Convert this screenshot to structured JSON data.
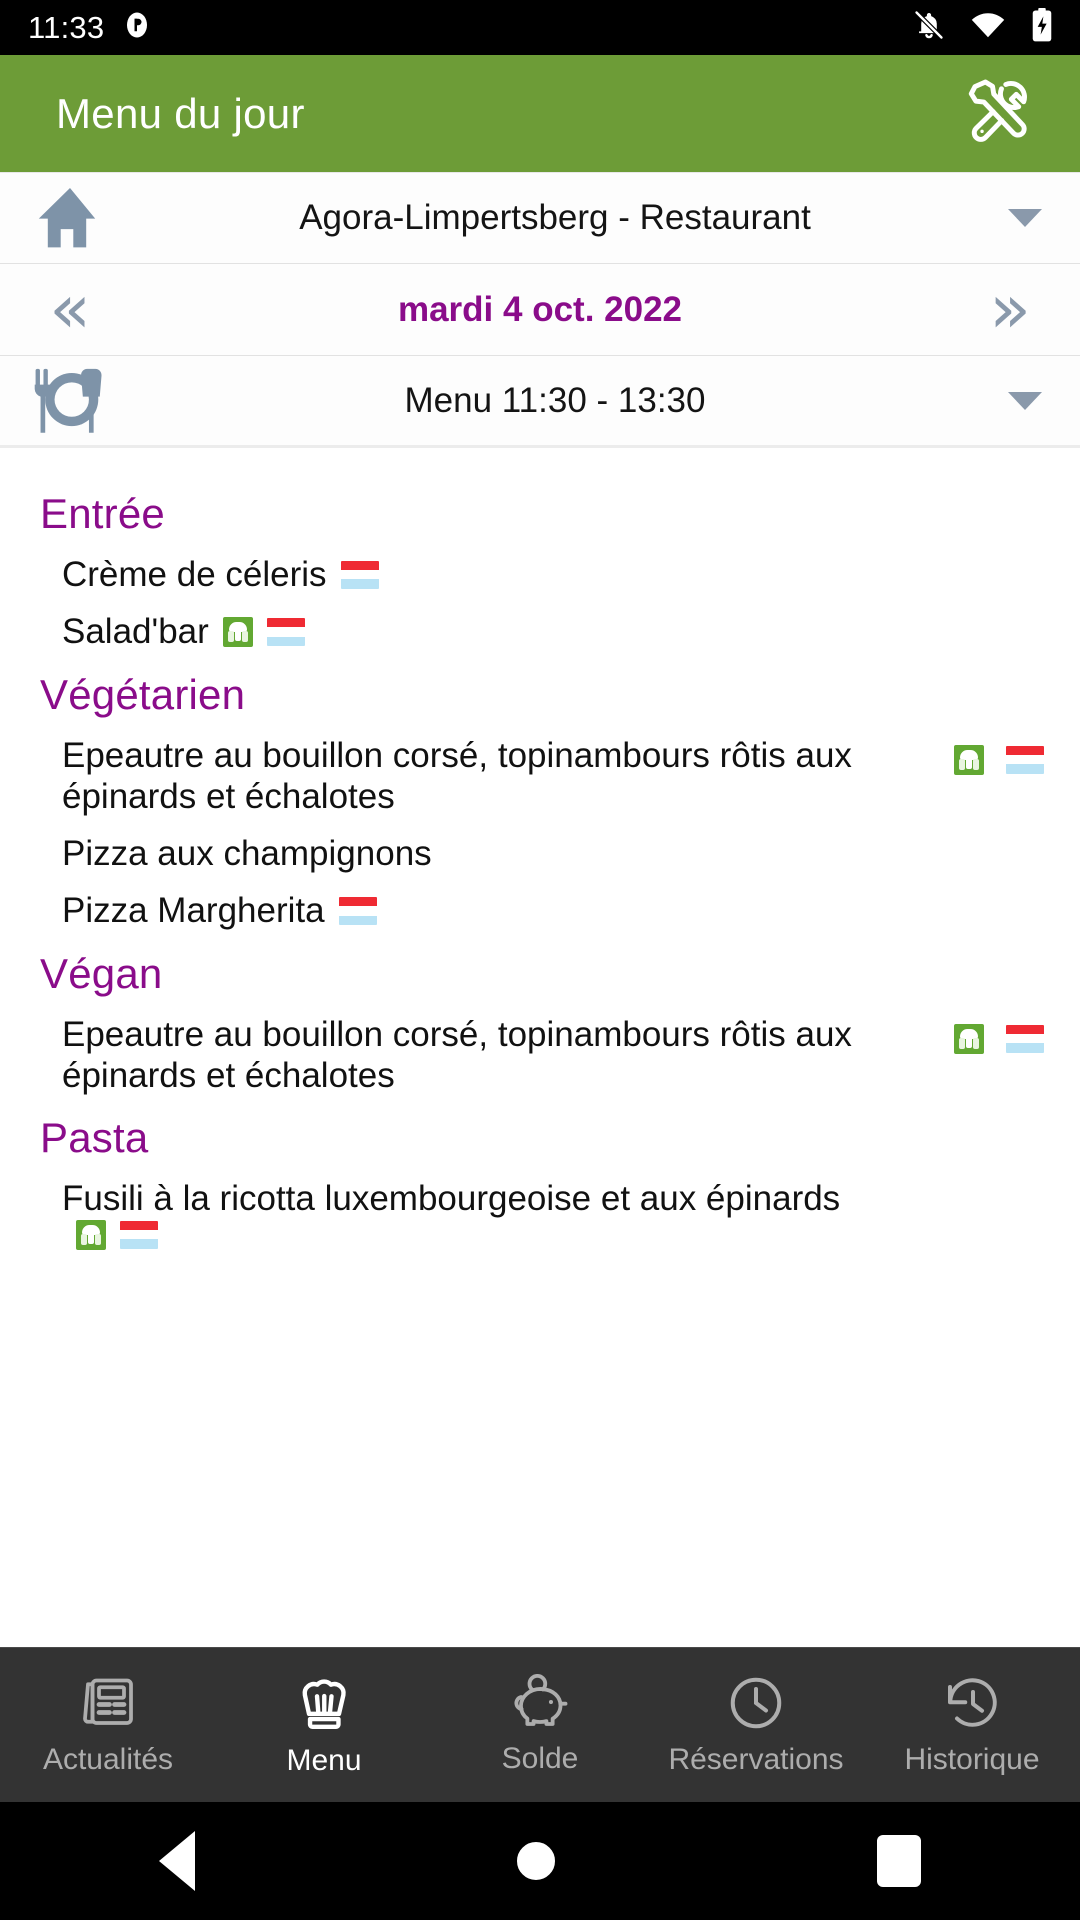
{
  "status_bar": {
    "time": "11:33",
    "icons": [
      "notifications-off-icon",
      "wifi-icon",
      "battery-charging-icon"
    ]
  },
  "app_bar": {
    "title": "Menu du jour",
    "action_icon": "tools-icon"
  },
  "selectors": {
    "restaurant": {
      "icon": "home-icon",
      "value": "Agora-Limpertsberg - Restaurant",
      "caret": "chevron-down-icon"
    },
    "date": {
      "prev": "«",
      "value": "mardi 4 oct. 2022",
      "next": "»"
    },
    "meal": {
      "icon": "cutlery-icon",
      "value": "Menu 11:30 - 13:30",
      "caret": "chevron-down-icon"
    }
  },
  "menu_sections": [
    {
      "title": "Entrée",
      "dishes": [
        {
          "name": "Crème de céleris",
          "vegetarian": false,
          "lux": true,
          "badges_position": "inline"
        },
        {
          "name": "Salad'bar",
          "vegetarian": true,
          "lux": true,
          "badges_position": "inline"
        }
      ]
    },
    {
      "title": "Végétarien",
      "dishes": [
        {
          "name": "Epeautre au bouillon corsé, topinambours rôtis aux épinards et échalotes",
          "vegetarian": true,
          "lux": true,
          "badges_position": "right"
        },
        {
          "name": "Pizza aux champignons",
          "vegetarian": false,
          "lux": false,
          "badges_position": "inline"
        },
        {
          "name": "Pizza Margherita",
          "vegetarian": false,
          "lux": true,
          "badges_position": "inline"
        }
      ]
    },
    {
      "title": "Végan",
      "dishes": [
        {
          "name": "Epeautre au bouillon corsé, topinambours rôtis aux épinards et échalotes",
          "vegetarian": true,
          "lux": true,
          "badges_position": "right"
        }
      ]
    },
    {
      "title": "Pasta",
      "dishes": [
        {
          "name": "Fusili à la ricotta luxembourgeoise et aux épinards",
          "vegetarian": true,
          "lux": true,
          "badges_position": "inline"
        }
      ]
    }
  ],
  "bottom_nav": {
    "items": [
      {
        "label": "Actualités",
        "icon": "newspaper-icon",
        "active": false
      },
      {
        "label": "Menu",
        "icon": "chef-hat-icon",
        "active": true
      },
      {
        "label": "Solde",
        "icon": "piggy-bank-icon",
        "active": false
      },
      {
        "label": "Réservations",
        "icon": "clock-icon",
        "active": false
      },
      {
        "label": "Historique",
        "icon": "history-icon",
        "active": false
      }
    ]
  },
  "system_nav": {
    "back": "back-triangle-icon",
    "home": "home-circle-icon",
    "recents": "recents-square-icon"
  },
  "colors": {
    "app_bar_green": "#6d9c37",
    "heading_purple": "#8a0c8a",
    "flag_red": "#ef2a33",
    "flag_blue": "#b8e2f5",
    "veg_green": "#62a832",
    "nav_background": "#333333"
  }
}
